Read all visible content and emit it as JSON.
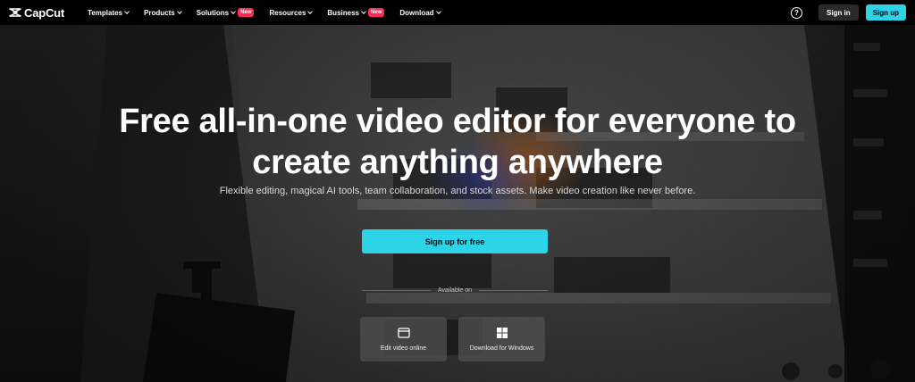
{
  "brand": {
    "name": "CapCut"
  },
  "nav": {
    "items": [
      {
        "label": "Templates",
        "badge": ""
      },
      {
        "label": "Products",
        "badge": ""
      },
      {
        "label": "Solutions",
        "badge": "New"
      },
      {
        "label": "Resources",
        "badge": ""
      },
      {
        "label": "Business",
        "badge": "New"
      },
      {
        "label": "Download",
        "badge": ""
      }
    ],
    "help_icon": "question-circle-icon",
    "sign_in": "Sign in",
    "sign_up": "Sign up"
  },
  "hero": {
    "title_line1": "Free all-in-one video editor for everyone to",
    "title_line2": "create anything anywhere",
    "subtitle": "Flexible editing, magical AI tools, team collaboration, and stock assets. Make video creation like never before.",
    "cta": "Sign up for free",
    "available_on": "Available on",
    "platforms": [
      {
        "label": "Edit video online",
        "icon": "browser-window-icon"
      },
      {
        "label": "Download for Windows",
        "icon": "windows-logo-icon"
      }
    ]
  },
  "colors": {
    "accent": "#2dd4e8",
    "badge": "#fe2c55",
    "nav_bg": "#000000"
  }
}
